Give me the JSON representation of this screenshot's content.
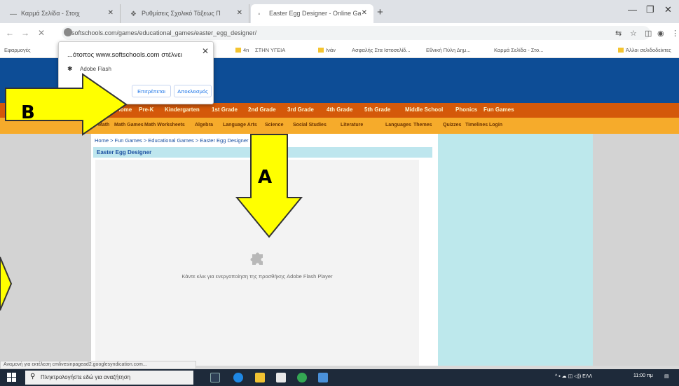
{
  "browser": {
    "tabs": [
      {
        "title": "Καρμά Σελίδα - Στοιχ"
      },
      {
        "title": "Ρυθμίσεις Σχολικό Τάξεως Π"
      },
      {
        "title": "Easter Egg Designer - Online Ga"
      }
    ],
    "address": "softschools.com/games/educational_games/easter_egg_designer/",
    "bookmarks": [
      "Εφαρμογές",
      "4n",
      "ΣΤΗΝ ΥΓΕΙΑ",
      "Ινάν",
      "Ασφαλής Στα Ιστοσελίδ...",
      "Εθνική Πύλη Δημ...",
      "Καρμά Σελίδα - Στο...",
      "Άλλοι σελιδοδείκτες"
    ]
  },
  "popup": {
    "title": "...ότοπος www.softschools.com στέλνει",
    "subtitle": "Adobe Flash",
    "allow_label": "Επιτρέπεται",
    "block_label": "Αποκλεισμός"
  },
  "site": {
    "nav_primary": [
      "Home",
      "Pre-K",
      "Kindergarten",
      "1st Grade",
      "2nd Grade",
      "3rd Grade",
      "4th Grade",
      "5th Grade",
      "Middle School",
      "Phonics",
      "Fun Games"
    ],
    "nav_secondary": [
      "Math",
      "Math Games",
      "Math Worksheets",
      "Algebra",
      "Language Arts",
      "Science",
      "Social Studies",
      "Literature",
      "Languages",
      "Themes",
      "Quizzes",
      "Timelines",
      "Login"
    ],
    "breadcrumb": "Home > Fun Games > Educational Games > Easter Egg Designer",
    "game_title": "Easter Egg Designer",
    "plugin_message": "Κάντε κλικ για ενεργοποίηση της προσθήκης Adobe Flash Player"
  },
  "status_bar": "Αναμονή για εκτέλεση cmlivesinpagead2.googlesyndication.com...",
  "taskbar": {
    "search_placeholder": "Πληκτρολογήστε εδώ για αναζήτηση",
    "clock": "11:00 πμ"
  },
  "annotations": {
    "a_label": "A",
    "b_label": "B",
    "arrow_color": "#ffff00"
  },
  "colors": {
    "header_blue": "#0d4d96",
    "nav_orange": "#d4590a",
    "nav_yellow": "#f6ab2b",
    "sidebar_cyan": "#bde8ec"
  }
}
